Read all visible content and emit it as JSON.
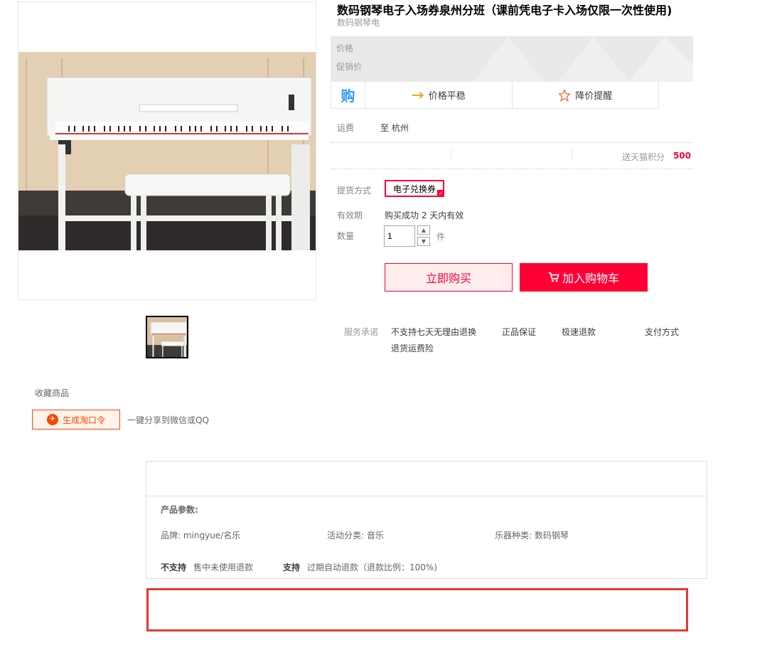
{
  "product": {
    "title": "数码钢琴电子入场券泉州分班（课前凭电子卡入场仅限一次性使用)",
    "subtitle": "数码钢琴电"
  },
  "price": {
    "price_label": "价格",
    "promo_label": "促销价"
  },
  "promo_bar": {
    "badge": "购",
    "trend_label": "价格平稳",
    "alert_label": "降价提醒"
  },
  "shipping": {
    "label": "运费",
    "value": "至 杭州"
  },
  "stats": {
    "points_label": "送天猫积分",
    "points_value": "500"
  },
  "delivery": {
    "label": "提货方式",
    "option": "电子兑换券"
  },
  "validity": {
    "label": "有效期",
    "value": "购买成功 2 天内有效"
  },
  "quantity": {
    "label": "数量",
    "value": "1",
    "unit": "件"
  },
  "actions": {
    "buy_now": "立即购买",
    "add_cart": "加入购物车"
  },
  "service": {
    "label": "服务承诺",
    "items": [
      "不支持七天无理由退换",
      "正品保证",
      "极速退款",
      "支付方式",
      "退货运费险"
    ]
  },
  "share": {
    "favorite": "收藏商品",
    "tkl_button": "生成淘口令",
    "share_text": "一键分享到微信或QQ"
  },
  "params": {
    "heading": "产品参数:",
    "items": [
      "品牌: mingyue/名乐",
      "活动分类: 音乐",
      "乐器种类: 数码钢琴"
    ],
    "refund": [
      {
        "tag": "不支持",
        "text": "售中未使用退款"
      },
      {
        "tag": "支持",
        "text": "过期自动退款（退款比例：100%)"
      }
    ]
  },
  "colors": {
    "accent": "#ff0036",
    "taokouling": "#ff4400"
  }
}
